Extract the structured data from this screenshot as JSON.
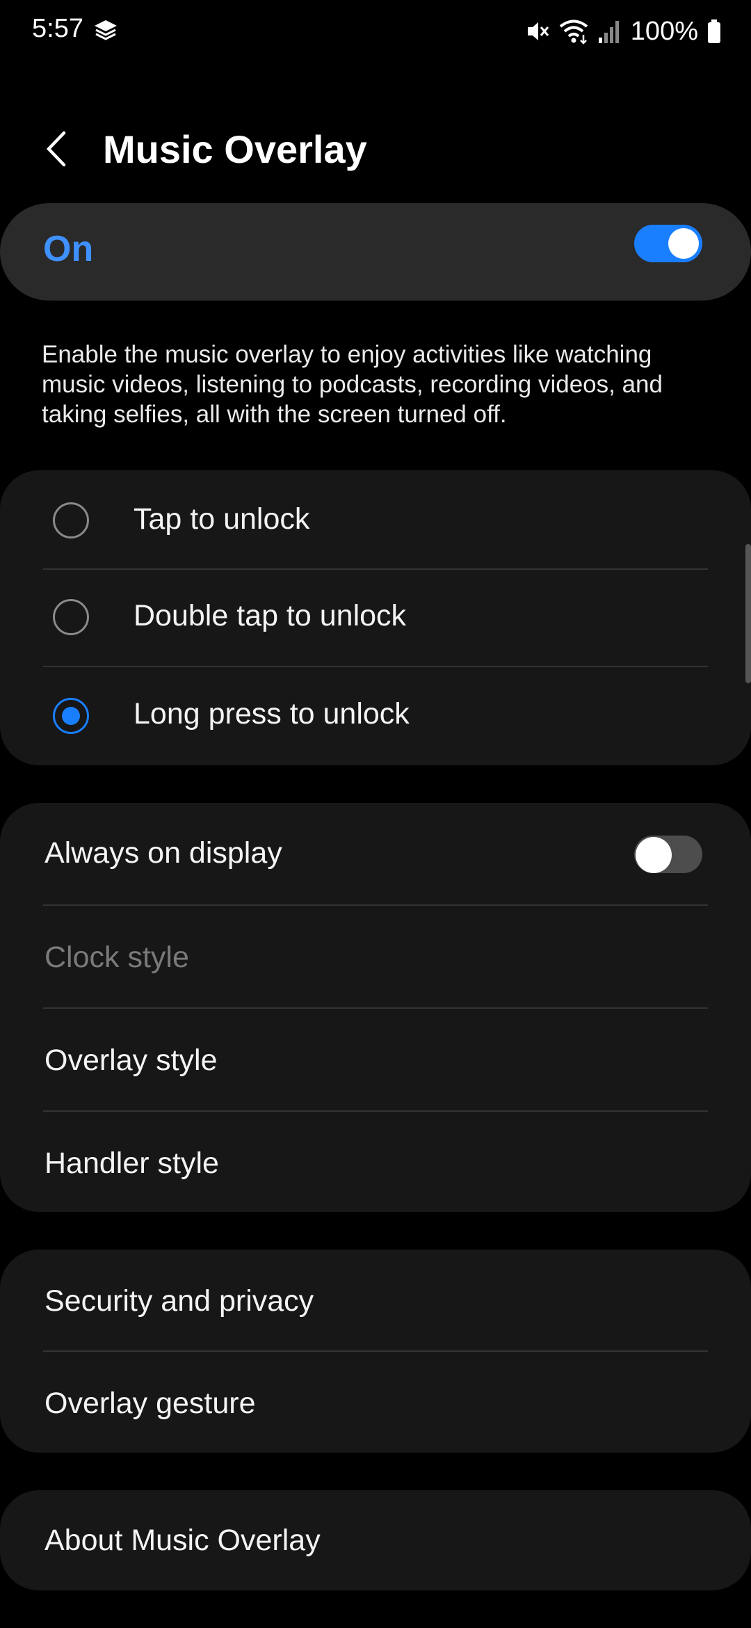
{
  "status_bar": {
    "time": "5:57",
    "battery": "100%",
    "icons": [
      "layers-icon",
      "mute-icon",
      "wifi-icon",
      "signal-icon",
      "battery-icon"
    ]
  },
  "header": {
    "title": "Music Overlay",
    "back_icon": "chevron-left-icon"
  },
  "master_switch": {
    "label": "On",
    "enabled": true
  },
  "description": "Enable the music overlay to enjoy activities like watching music videos, listening to podcasts, recording videos, and taking selfies, all with the screen turned off.",
  "unlock_options": {
    "items": [
      {
        "label": "Tap to unlock",
        "selected": false
      },
      {
        "label": "Double tap to unlock",
        "selected": false
      },
      {
        "label": "Long press to unlock",
        "selected": true
      }
    ]
  },
  "display_settings": {
    "always_on_display": {
      "label": "Always on display",
      "enabled": false
    },
    "clock_style": {
      "label": "Clock style",
      "disabled": true
    },
    "overlay_style": {
      "label": "Overlay style"
    },
    "handler_style": {
      "label": "Handler style"
    }
  },
  "security_settings": {
    "security_privacy": {
      "label": "Security and privacy"
    },
    "overlay_gesture": {
      "label": "Overlay gesture"
    }
  },
  "about": {
    "label": "About Music Overlay"
  },
  "colors": {
    "accent": "#1a7fff",
    "accent_text": "#3e91ff",
    "card_bg": "#171717",
    "switch_bg": "#2a2a2a",
    "background": "#000000"
  }
}
